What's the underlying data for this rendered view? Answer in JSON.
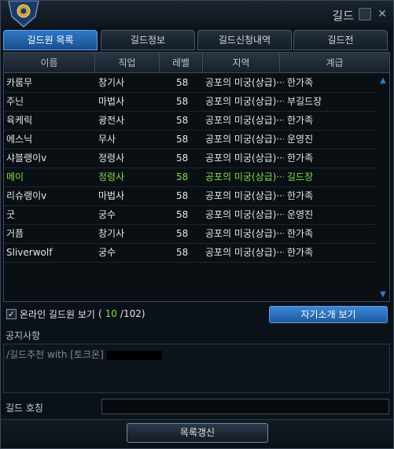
{
  "window": {
    "title": "길드"
  },
  "tabs": [
    {
      "label": "길드원 목록",
      "active": true
    },
    {
      "label": "길드정보",
      "active": false
    },
    {
      "label": "길드신청내역",
      "active": false
    },
    {
      "label": "길드전",
      "active": false
    }
  ],
  "table": {
    "headers": [
      "이름",
      "직업",
      "레벨",
      "지역",
      "계급"
    ],
    "rows": [
      {
        "name": "카룸무",
        "class": "창기사",
        "level": "58",
        "zone": "공포의 미궁(상급)···",
        "rank": "한가족"
      },
      {
        "name": "주닌",
        "class": "마법사",
        "level": "58",
        "zone": "공포의 미궁(상급)···",
        "rank": "부길드장"
      },
      {
        "name": "육케릭",
        "class": "광전사",
        "level": "58",
        "zone": "공포의 미궁(상급)···",
        "rank": "한가족"
      },
      {
        "name": "에스닉",
        "class": "무사",
        "level": "58",
        "zone": "공포의 미궁(상급)···",
        "rank": "운영진"
      },
      {
        "name": "샤블랭이v",
        "class": "정령사",
        "level": "58",
        "zone": "공포의 미궁(상급)···",
        "rank": "한가족"
      },
      {
        "name": "메이",
        "class": "정령사",
        "level": "58",
        "zone": "공포의 미궁(상급)···",
        "rank": "길드장",
        "self": true
      },
      {
        "name": "리슈랭이v",
        "class": "마법사",
        "level": "58",
        "zone": "공포의 미궁(상급)···",
        "rank": "한가족"
      },
      {
        "name": "굿",
        "class": "궁수",
        "level": "58",
        "zone": "공포의 미궁(상급)···",
        "rank": "운영진"
      },
      {
        "name": "거픔",
        "class": "창기사",
        "level": "58",
        "zone": "공포의 미궁(상급)···",
        "rank": "한가족"
      },
      {
        "name": "Sliverwolf",
        "class": "궁수",
        "level": "58",
        "zone": "공포의 미궁(상급)···",
        "rank": "한가족"
      }
    ]
  },
  "online": {
    "label": "온라인 길드원 보기",
    "open": "(",
    "count": "10",
    "total": "/102)",
    "checked": true
  },
  "buttons": {
    "intro": "자기소개 보기",
    "refresh": "목록갱신"
  },
  "notice": {
    "label": "공지사항",
    "text": "/길드추천 with   [토크온]"
  },
  "nickname": {
    "label": "길드 호칭",
    "value": ""
  },
  "colors": {
    "accent": "#2f78c8",
    "self_highlight": "#7ee04a"
  }
}
